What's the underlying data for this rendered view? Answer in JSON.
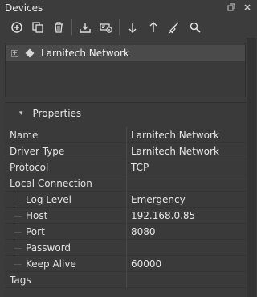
{
  "window": {
    "title": "Devices"
  },
  "toolbar": {
    "buttons": [
      {
        "icon": "add-icon"
      },
      {
        "icon": "copy-icon"
      },
      {
        "icon": "trash-icon"
      },
      {
        "icon": "import-icon"
      },
      {
        "icon": "connect-device-icon"
      },
      {
        "icon": "arrow-down-icon"
      },
      {
        "icon": "arrow-up-icon"
      },
      {
        "icon": "clear-icon"
      },
      {
        "icon": "search-icon"
      }
    ]
  },
  "tree": {
    "items": [
      {
        "label": "Larnitech Network",
        "expander": "+"
      }
    ]
  },
  "properties": {
    "header": "Properties",
    "rows": [
      {
        "key": "Name",
        "value": "Larnitech Network",
        "indent": false
      },
      {
        "key": "Driver Type",
        "value": "Larnitech Network",
        "indent": false
      },
      {
        "key": "Protocol",
        "value": "TCP",
        "indent": false
      },
      {
        "key": "Local Connection",
        "value": "",
        "indent": false
      },
      {
        "key": "Log Level",
        "value": "Emergency",
        "indent": true
      },
      {
        "key": "Host",
        "value": "192.168.0.85",
        "indent": true
      },
      {
        "key": "Port",
        "value": "8080",
        "indent": true
      },
      {
        "key": "Password",
        "value": "",
        "indent": true
      },
      {
        "key": "Keep Alive",
        "value": "60000",
        "indent": true
      },
      {
        "key": "Tags",
        "value": "",
        "indent": false
      }
    ]
  },
  "colors": {
    "background": "#3c3c3c",
    "selected_row": "#4a4a4a",
    "text": "#e6e6e6"
  }
}
